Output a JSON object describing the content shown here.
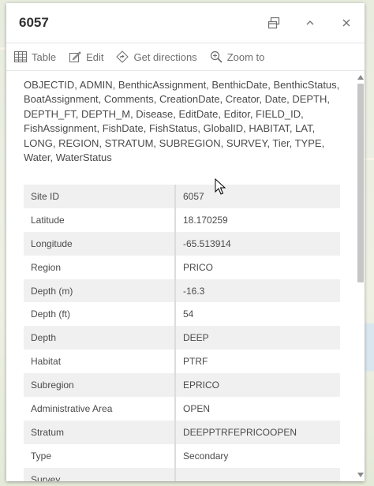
{
  "popup": {
    "title": "6057",
    "header_icons": [
      "dock-icon",
      "collapse-chevron-up-icon",
      "close-icon"
    ]
  },
  "toolbar": {
    "table_label": "Table",
    "edit_label": "Edit",
    "directions_label": "Get directions",
    "zoom_label": "Zoom to"
  },
  "fields_text": "OBJECTID, ADMIN, BenthicAssignment, BenthicDate, BenthicStatus, BoatAssignment, Comments, CreationDate, Creator, Date, DEPTH, DEPTH_FT, DEPTH_M, Disease, EditDate, Editor, FIELD_ID, FishAssignment, FishDate, FishStatus, GlobalID, HABITAT, LAT, LONG, REGION, STRATUM, SUBREGION, SURVEY, Tier, TYPE, Water, WaterStatus",
  "attributes": [
    {
      "key": "Site ID",
      "value": "6057"
    },
    {
      "key": "Latitude",
      "value": "18.170259"
    },
    {
      "key": "Longitude",
      "value": "-65.513914"
    },
    {
      "key": "Region",
      "value": "PRICO"
    },
    {
      "key": "Depth (m)",
      "value": "-16.3"
    },
    {
      "key": "Depth (ft)",
      "value": "54"
    },
    {
      "key": "Depth",
      "value": "DEEP"
    },
    {
      "key": "Habitat",
      "value": "PTRF"
    },
    {
      "key": "Subregion",
      "value": "EPRICO"
    },
    {
      "key": "Administrative Area",
      "value": "OPEN"
    },
    {
      "key": "Stratum",
      "value": "DEEPPTRFEPRICOOPEN"
    },
    {
      "key": "Type",
      "value": "Secondary"
    },
    {
      "key": "Survey",
      "value": ""
    }
  ],
  "colors": {
    "title_text": "#323232",
    "body_text": "#4a4a4a",
    "icon_gray": "#6e6e6e",
    "row_stripe": "#f0f0f0"
  }
}
